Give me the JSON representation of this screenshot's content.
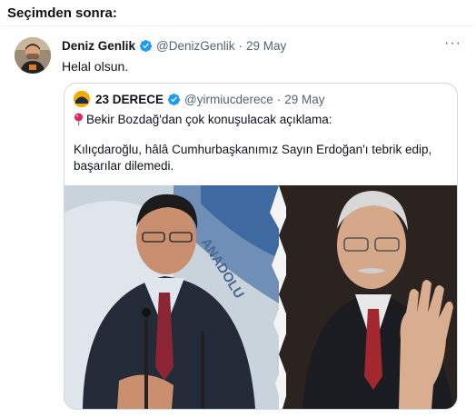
{
  "heading": "Seçimden sonra:",
  "tweet": {
    "author_name": "Deniz Genlik",
    "handle": "@DenizGenlik",
    "separator": "·",
    "date": "29 May",
    "text": "Helal olsun.",
    "more_label": "···",
    "quoted": {
      "author_name": "23 DERECE",
      "handle": "@yirmiucderece",
      "separator": "·",
      "date": "29 May",
      "line1": "Bekir Bozdağ'dan çok konuşulacak açıklama:",
      "line2": "Kılıçdaroğlu, hâlâ Cumhurbaşkanımız Sayın Erdoğan'ı tebrik edip, başarılar dilemedi.",
      "image_text": "ANADOLU"
    }
  },
  "colors": {
    "verified": "#1d9bf0",
    "muted": "#536471",
    "border": "#cfd9de",
    "pin": "#e0245e"
  },
  "icons": {
    "verified": "verified-badge-icon",
    "pin": "map-pin-icon",
    "more": "more-options-icon"
  }
}
